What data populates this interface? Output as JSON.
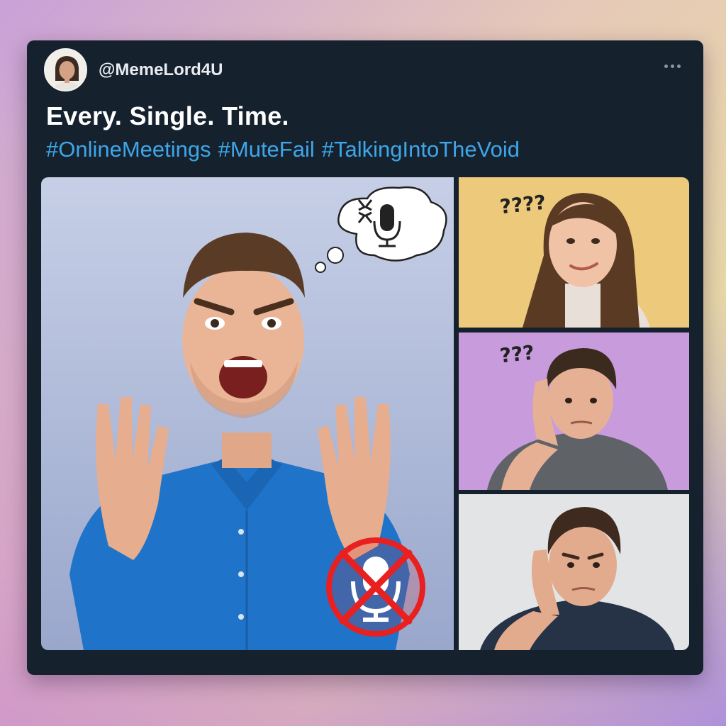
{
  "post": {
    "username": "@MemeLord4U",
    "caption": "Every. Single. Time.",
    "hashtags": [
      "#OnlineMeetings",
      "#MuteFail",
      "#TalkingIntoTheVoid"
    ]
  },
  "icons": {
    "avatar": "avatar",
    "more": "more-options-icon",
    "thought_mic": "microphone-icon",
    "anger": "anger-icon",
    "muted_mic": "muted-microphone-icon"
  },
  "tiles": {
    "tile_1": {
      "reaction": "????"
    },
    "tile_2": {
      "reaction": "???"
    }
  },
  "colors": {
    "card_bg": "#16212e",
    "hashtag": "#3ea6e8",
    "mute_red": "#e82020"
  }
}
